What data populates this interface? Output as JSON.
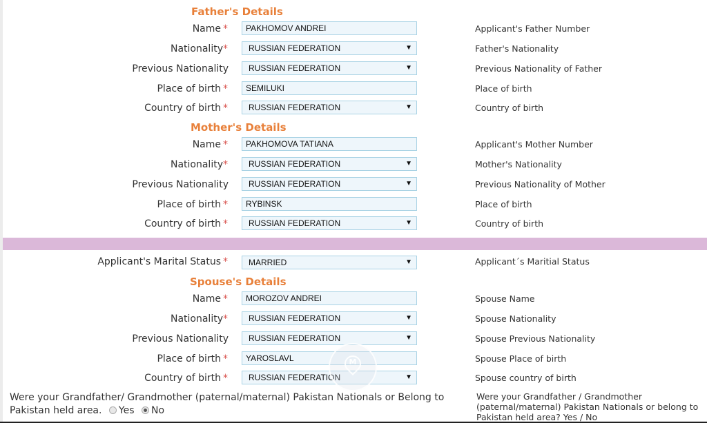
{
  "father": {
    "title": "Father's Details",
    "fields": [
      {
        "label": "Name",
        "required_mark": "*",
        "type": "input",
        "value": "PAKHOMOV ANDREI",
        "hint": "Applicant's Father Number"
      },
      {
        "label": "Nationality",
        "required_mark": "*",
        "type": "select",
        "value": "RUSSIAN FEDERATION",
        "hint": "Father's Nationality"
      },
      {
        "label": "Previous Nationality",
        "required_mark": "",
        "type": "select",
        "value": "RUSSIAN FEDERATION",
        "hint": "Previous Nationality of Father"
      },
      {
        "label": "Place of birth",
        "required_mark": "*",
        "type": "input",
        "value": "SEMILUKI",
        "hint": "Place of birth"
      },
      {
        "label": "Country of birth",
        "required_mark": "*",
        "type": "select",
        "value": "RUSSIAN FEDERATION",
        "hint": "Country of birth"
      }
    ]
  },
  "mother": {
    "title": "Mother's Details",
    "fields": [
      {
        "label": "Name",
        "required_mark": "*",
        "type": "input",
        "value": "PAKHOMOVA TATIANA",
        "hint": "Applicant's Mother Number"
      },
      {
        "label": "Nationality",
        "required_mark": "*",
        "type": "select",
        "value": "RUSSIAN FEDERATION",
        "hint": "Mother's Nationality"
      },
      {
        "label": "Previous Nationality",
        "required_mark": "",
        "type": "select",
        "value": "RUSSIAN FEDERATION",
        "hint": "Previous Nationality of Mother"
      },
      {
        "label": "Place of birth",
        "required_mark": "*",
        "type": "input",
        "value": "RYBINSK",
        "hint": "Place of birth"
      },
      {
        "label": "Country of birth",
        "required_mark": "*",
        "type": "select",
        "value": "RUSSIAN FEDERATION",
        "hint": "Country of birth"
      }
    ]
  },
  "marital": {
    "label": "Applicant's Marital Status",
    "required_mark": "*",
    "value": "MARRIED",
    "hint": "Applicant´s Maritial Status"
  },
  "spouse": {
    "title": "Spouse's Details",
    "fields": [
      {
        "label": "Name",
        "required_mark": "*",
        "type": "input",
        "value": "MOROZOV ANDREI",
        "hint": "Spouse Name"
      },
      {
        "label": "Nationality",
        "required_mark": "*",
        "type": "select",
        "value": "RUSSIAN FEDERATION",
        "hint": "Spouse Nationality"
      },
      {
        "label": "Previous Nationality",
        "required_mark": "",
        "type": "select",
        "value": "RUSSIAN FEDERATION",
        "hint": "Spouse Previous Nationality"
      },
      {
        "label": "Place of birth",
        "required_mark": "*",
        "type": "input",
        "value": "YAROSLAVL",
        "hint": "Spouse Place of birth"
      },
      {
        "label": "Country of birth",
        "required_mark": "*",
        "type": "select",
        "value": "RUSSIAN FEDERATION",
        "hint": "Spouse country of birth"
      }
    ]
  },
  "grandparents": {
    "question": "Were your Grandfather/ Grandmother (paternal/maternal) Pakistan Nationals or Belong to Pakistan held area.",
    "options": [
      {
        "label": "Yes",
        "checked": false
      },
      {
        "label": "No",
        "checked": true
      }
    ],
    "hint": "Were your Grandfather / Grandmother (paternal/maternal) Pakistan Nationals or belong to Pakistan held area? Yes / No"
  },
  "icons": {
    "select_arrow": "▼",
    "watermark": "M"
  },
  "colors": {
    "section_title": "#e8803a",
    "required": "#d9534f",
    "divider_band": "#dbb8d9",
    "field_border": "#a8d2e4",
    "field_bg": "#eef6fb"
  }
}
